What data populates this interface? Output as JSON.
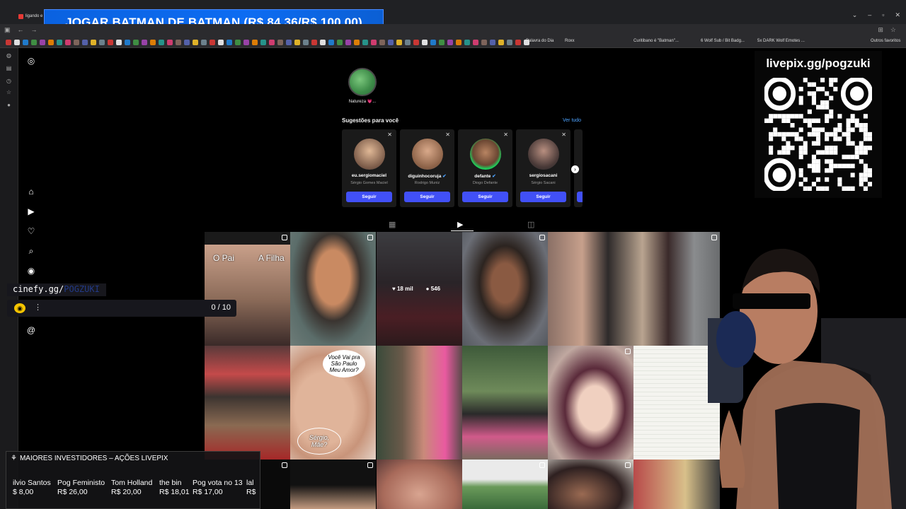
{
  "browser": {
    "tab_title": "ligando e",
    "bookmarks": [
      "Palavra do Dia",
      "Roxx",
      "Curitibano é \"Batman\"...",
      "6 Wolf Sub / Bit Badg...",
      "5x DARK Wolf Emotes ..."
    ],
    "other_bookmarks": "Outros favoritos"
  },
  "overlay": {
    "banner_text": "JOGAR BATMAN DE BATMAN (R$ 84,36/R$ 100,00)",
    "qr_title": "livepix.gg/pogzuki"
  },
  "profile": {
    "highlight_label": "Natureza 💗...",
    "suggestions_title": "Sugestões para você",
    "see_all": "Ver tudo",
    "suggestions": [
      {
        "username": "eu.sergiomaciel",
        "realname": "Sérgio Gomes Maciel",
        "button": "Seguir",
        "verified": false,
        "color": "#c99d7b"
      },
      {
        "username": "diguinhocoruja",
        "realname": "Rodrigo Muniz",
        "button": "Seguir",
        "verified": true,
        "color": "#b58d73"
      },
      {
        "username": "defante",
        "realname": "Diogo Defante",
        "button": "Seguir",
        "verified": true,
        "color": "#a57656"
      },
      {
        "username": "sergiosacani",
        "realname": "Sérgio Sacani",
        "button": "Seguir",
        "verified": false,
        "color": "#8a6a5c"
      }
    ],
    "grid_captions": {
      "left": "O Pai",
      "right": "A Filha",
      "bubble_top": "Você Vai pra São Paulo Meu Amor?",
      "bubble_bottom": "Sérgio, Mãe?"
    },
    "hover_stats": {
      "likes": "18 mil",
      "comments": "546"
    }
  },
  "chat": {
    "label": "cinefy.gg/",
    "label_dim": "POGZUKI",
    "count": "0 / 10"
  },
  "investors": {
    "title": "MAIORES INVESTIDORES – AÇÕES LIVEPIX",
    "items": [
      {
        "name": "ilvio Santos",
        "value": "$ 8,00"
      },
      {
        "name": "Pog Feministo",
        "value": "R$ 26,00"
      },
      {
        "name": "Tom Holland",
        "value": "R$ 20,00"
      },
      {
        "name": "the bin",
        "value": "R$ 18,01"
      },
      {
        "name": "Pog vota no 13",
        "value": "R$ 17,00"
      },
      {
        "name": "lal",
        "value": "R$"
      }
    ]
  }
}
